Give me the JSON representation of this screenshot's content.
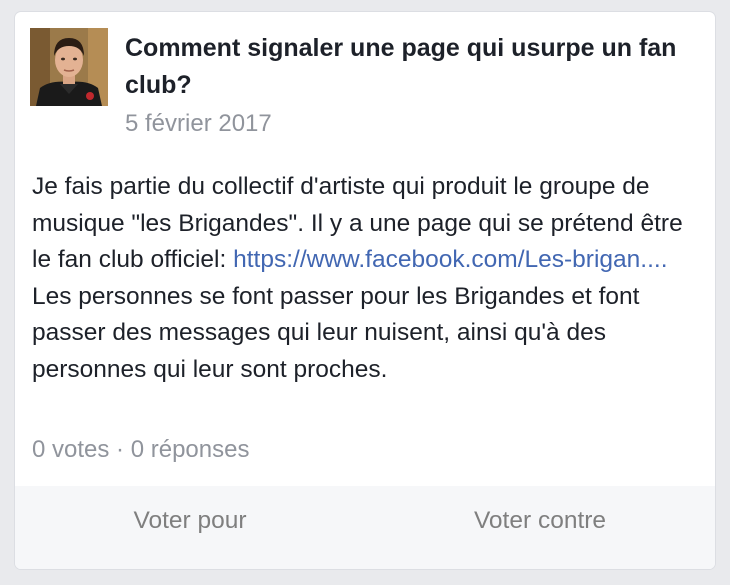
{
  "post": {
    "title": "Comment signaler une page qui usurpe un fan club?",
    "date": "5 février 2017",
    "body_part1": "Je fais partie du collectif d'artiste qui produit le groupe de musique \"les Brigandes\". Il y a une page qui se prétend être le fan club officiel: ",
    "link_text": "https://www.facebook.com/Les-brigan....",
    "body_part2": " Les personnes se font passer pour les Brigandes et font passer des messages qui leur nuisent, ainsi qu'à des personnes qui leur sont proches.",
    "stats": "0 votes · 0 réponses"
  },
  "actions": {
    "vote_for": "Voter pour",
    "vote_against": "Voter contre"
  },
  "colors": {
    "link": "#4267b2",
    "secondary_text": "#90949c",
    "primary_text": "#1d2129"
  }
}
